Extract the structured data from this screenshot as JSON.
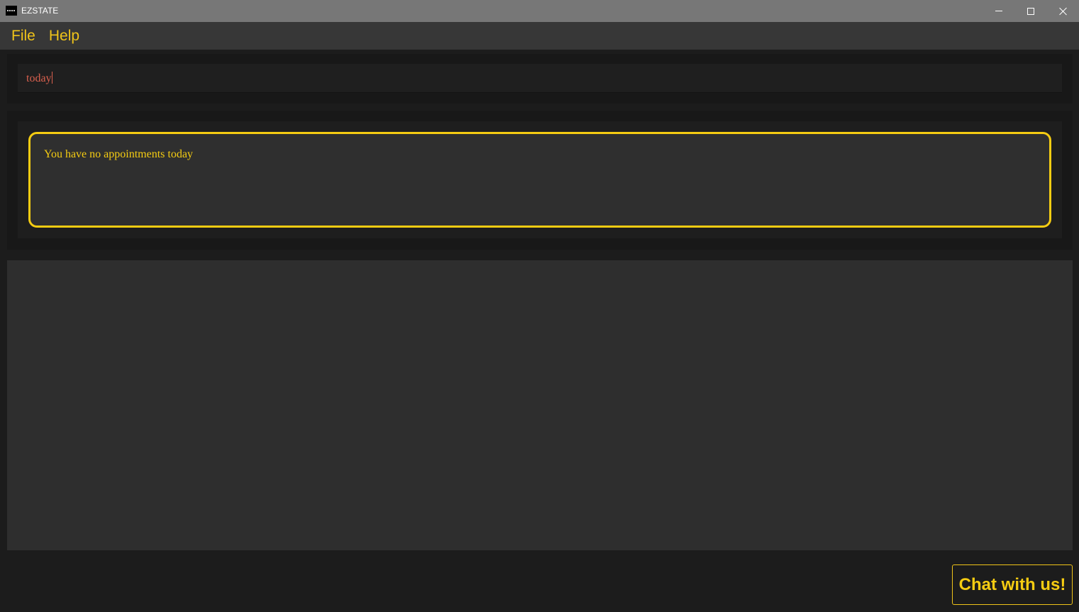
{
  "window": {
    "title": "EZSTATE",
    "logo_icon": "app-logo-icon",
    "controls": [
      "minimize-icon",
      "maximize-icon",
      "close-icon"
    ]
  },
  "menu": {
    "items": [
      {
        "label": "File"
      },
      {
        "label": "Help"
      }
    ]
  },
  "command": {
    "value": "today"
  },
  "result": {
    "message": "You have no appointments today"
  },
  "chat_button": {
    "label": "Chat with us!"
  },
  "colors": {
    "accent": "#f5cc12",
    "command_text": "#d9604e",
    "background": "#1c1c1c",
    "titlebar": "#777777"
  }
}
